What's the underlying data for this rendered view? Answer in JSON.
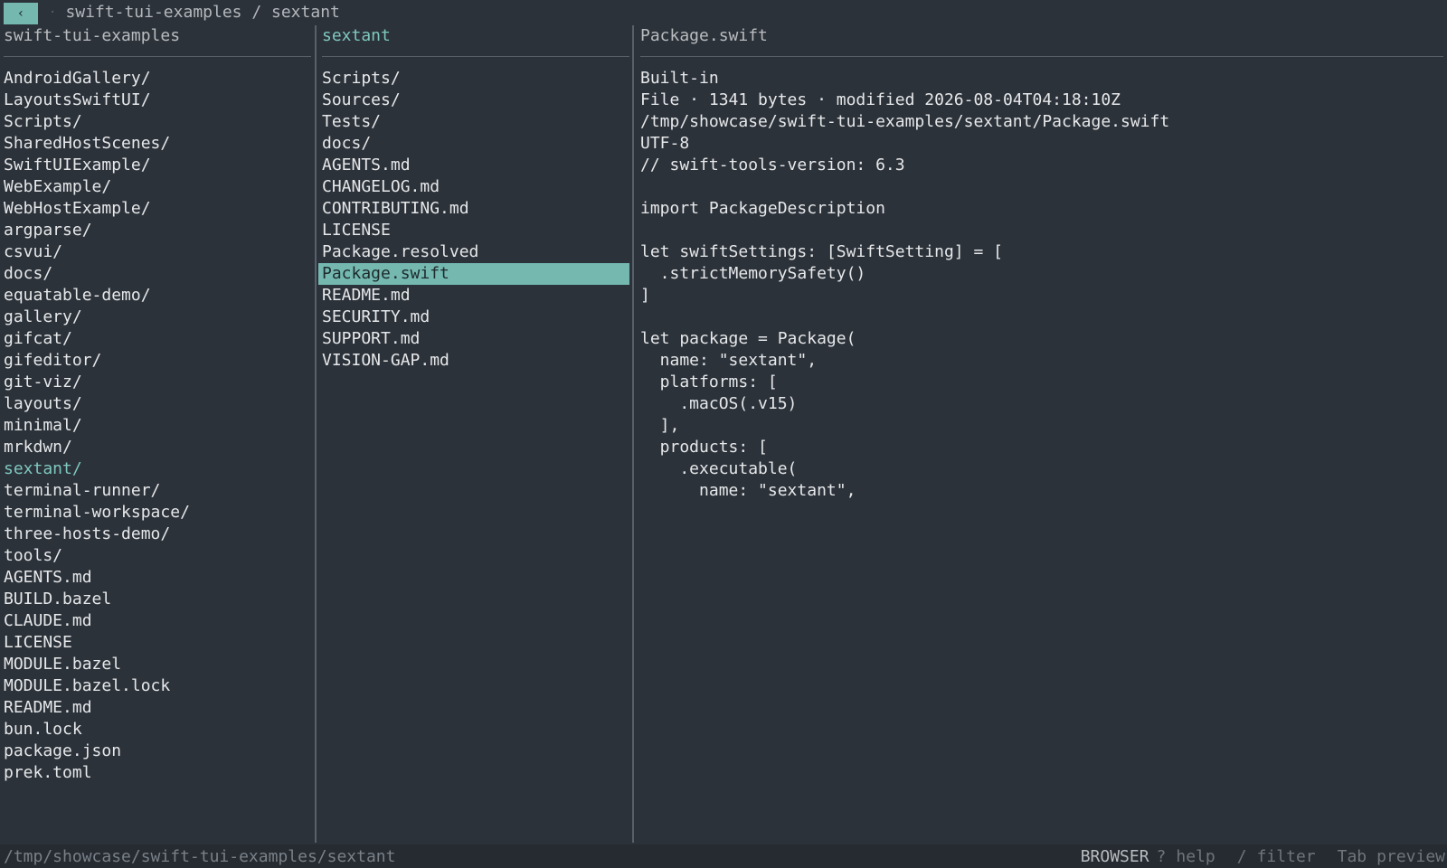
{
  "titlebar": {
    "back_label": "‹",
    "separator": "·",
    "path": "swift-tui-examples / sextant"
  },
  "left_pane": {
    "header": "swift-tui-examples",
    "items": [
      "AndroidGallery/",
      "LayoutsSwiftUI/",
      "Scripts/",
      "SharedHostScenes/",
      "SwiftUIExample/",
      "WebExample/",
      "WebHostExample/",
      "argparse/",
      "csvui/",
      "docs/",
      "equatable-demo/",
      "gallery/",
      "gifcat/",
      "gifeditor/",
      "git-viz/",
      "layouts/",
      "minimal/",
      "mrkdwn/",
      "sextant/",
      "terminal-runner/",
      "terminal-workspace/",
      "three-hosts-demo/",
      "tools/",
      "AGENTS.md",
      "BUILD.bazel",
      "CLAUDE.md",
      "LICENSE",
      "MODULE.bazel",
      "MODULE.bazel.lock",
      "README.md",
      "bun.lock",
      "package.json",
      "prek.toml"
    ],
    "current_item": "sextant/"
  },
  "middle_pane": {
    "header": "sextant",
    "items": [
      "Scripts/",
      "Sources/",
      "Tests/",
      "docs/",
      "AGENTS.md",
      "CHANGELOG.md",
      "CONTRIBUTING.md",
      "LICENSE",
      "Package.resolved",
      "Package.swift",
      "README.md",
      "SECURITY.md",
      "SUPPORT.md",
      "VISION-GAP.md"
    ],
    "selected_item": "Package.swift"
  },
  "preview": {
    "header": "Package.swift",
    "kind": "Built-in",
    "info": "File · 1341 bytes · modified 2026-08-04T04:18:10Z",
    "full_path": "/tmp/showcase/swift-tui-examples/sextant/Package.swift",
    "encoding": "UTF-8",
    "code_lines": [
      "// swift-tools-version: 6.3",
      "",
      "import PackageDescription",
      "",
      "let swiftSettings: [SwiftSetting] = [",
      "  .strictMemorySafety()",
      "]",
      "",
      "let package = Package(",
      "  name: \"sextant\",",
      "  platforms: [",
      "    .macOS(.v15)",
      "  ],",
      "  products: [",
      "    .executable(",
      "      name: \"sextant\","
    ]
  },
  "statusbar": {
    "path": "/tmp/showcase/swift-tui-examples/sextant",
    "mode": "BROWSER",
    "hints": [
      {
        "key": "?",
        "label": "help"
      },
      {
        "key": "/",
        "label": "filter"
      },
      {
        "key": "Tab",
        "label": "preview"
      }
    ]
  },
  "colors": {
    "background": "#2c323a",
    "accent": "#74b8b0",
    "accent_text": "#7ec8be",
    "divider": "#59606a"
  }
}
